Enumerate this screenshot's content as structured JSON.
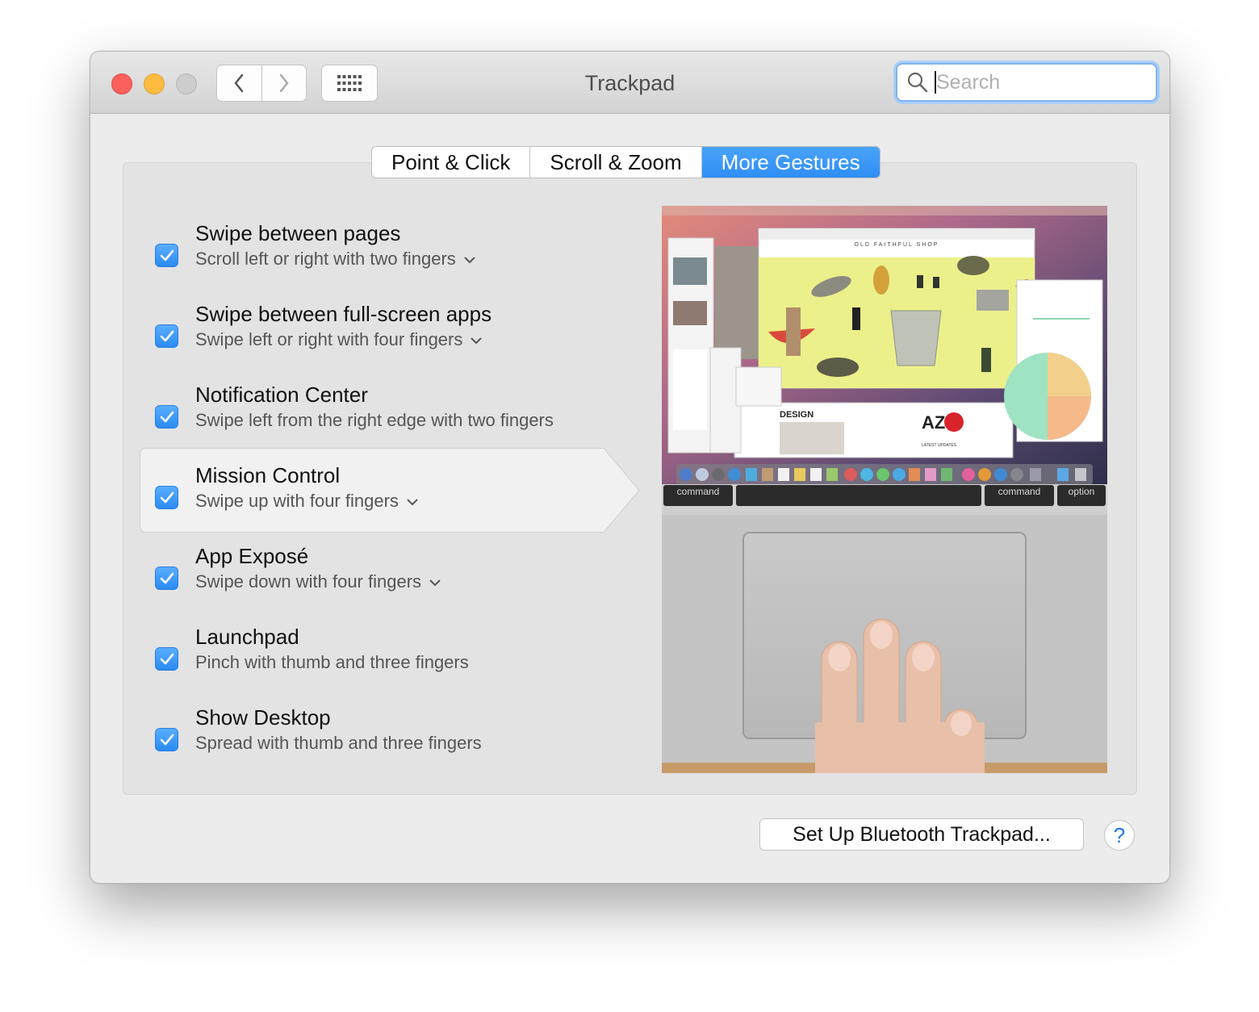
{
  "window": {
    "title": "Trackpad"
  },
  "search": {
    "placeholder": "Search"
  },
  "tabs": [
    {
      "label": "Point & Click"
    },
    {
      "label": "Scroll & Zoom"
    },
    {
      "label": "More Gestures"
    }
  ],
  "gestures": [
    {
      "title": "Swipe between pages",
      "subtitle": "Scroll left or right with two fingers",
      "checked": true
    },
    {
      "title": "Swipe between full-screen apps",
      "subtitle": "Swipe left or right with four fingers",
      "checked": true
    },
    {
      "title": "Notification Center",
      "subtitle": "Swipe left from the right edge with two fingers",
      "checked": true
    },
    {
      "title": "Mission Control",
      "subtitle": "Swipe up with four fingers",
      "checked": true
    },
    {
      "title": "App Exposé",
      "subtitle": "Swipe down with four fingers",
      "checked": true
    },
    {
      "title": "Launchpad",
      "subtitle": "Pinch with thumb and three fingers",
      "checked": true
    },
    {
      "title": "Show Desktop",
      "subtitle": "Spread with thumb and three fingers",
      "checked": true
    }
  ],
  "preview": {
    "shop_title": "OLD FAITHFUL SHOP",
    "design_label": "DESIGN",
    "az_label": "AZ",
    "latest_label": "LATEST UPDATES",
    "key_command_left": "command",
    "key_command_right": "command",
    "key_option": "option"
  },
  "footer": {
    "setup_label": "Set Up Bluetooth Trackpad...",
    "help_label": "?"
  },
  "colors": {
    "accent": "#3a99f6",
    "close": "#fc605c",
    "minimize": "#fdbc40",
    "zoom": "#cdcdcd"
  }
}
